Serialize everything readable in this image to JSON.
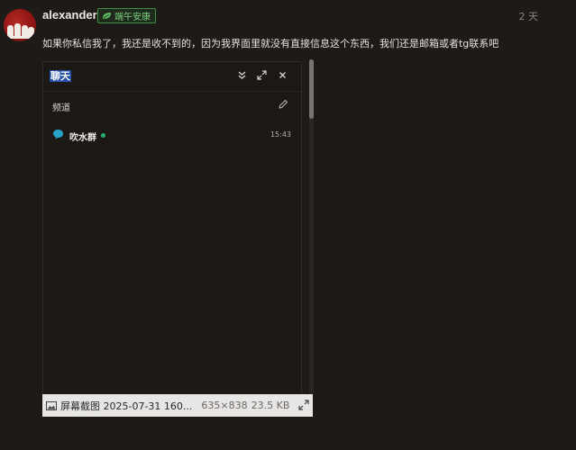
{
  "post": {
    "username": "alexander",
    "badge": {
      "label": "端午安康",
      "icon": "leaf-icon",
      "color": "#3d8f41"
    },
    "time": "2 天",
    "body": "如果你私信我了，我还是收不到的，因为我界面里就没有直接信息这个东西，我们还是邮箱或者tg联系吧"
  },
  "screenshot": {
    "chat": {
      "title": "聊天",
      "header_icons": [
        "collapse-icon",
        "expand-icon",
        "close-icon"
      ],
      "channels_label": "频道",
      "channels": [
        {
          "name": "吹水群",
          "time": "15:43",
          "status": "online",
          "icon": "chat-bubble-icon",
          "status_color": "#28b072"
        }
      ]
    },
    "caption": {
      "filename": "屏幕截图 2025-07-31 160...",
      "dimensions": "635×838",
      "size": "23.5 KB"
    }
  }
}
